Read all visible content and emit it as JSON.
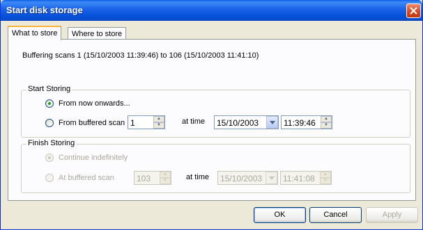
{
  "window": {
    "title": "Start disk storage"
  },
  "tabs": [
    {
      "label": "What to store",
      "active": true
    },
    {
      "label": "Where to store",
      "active": false
    }
  ],
  "info_text": "Buffering scans 1 (15/10/2003 11:39:46) to 106 (15/10/2003 11:41:10)",
  "start_storing": {
    "legend": "Start Storing",
    "options": [
      {
        "label": "From now onwards...",
        "selected": true
      },
      {
        "label": "From buffered scan",
        "selected": false
      }
    ],
    "scan_value": "1",
    "at_time_label": "at time",
    "date_value": "15/10/2003",
    "time_value": "11:39:46"
  },
  "finish_storing": {
    "legend": "Finish Storing",
    "enabled": false,
    "options": [
      {
        "label": "Continue indefinitely",
        "selected": true
      },
      {
        "label": "At buffered scan",
        "selected": false
      }
    ],
    "scan_value": "103",
    "at_time_label": "at time",
    "date_value": "15/10/2003",
    "time_value": "11:41:08"
  },
  "buttons": {
    "ok": "OK",
    "cancel": "Cancel",
    "apply": "Apply"
  },
  "colors": {
    "titlebar": "#0a5ee6",
    "dialog_bg": "#ece9d8",
    "radio_dot": "#21a121"
  }
}
